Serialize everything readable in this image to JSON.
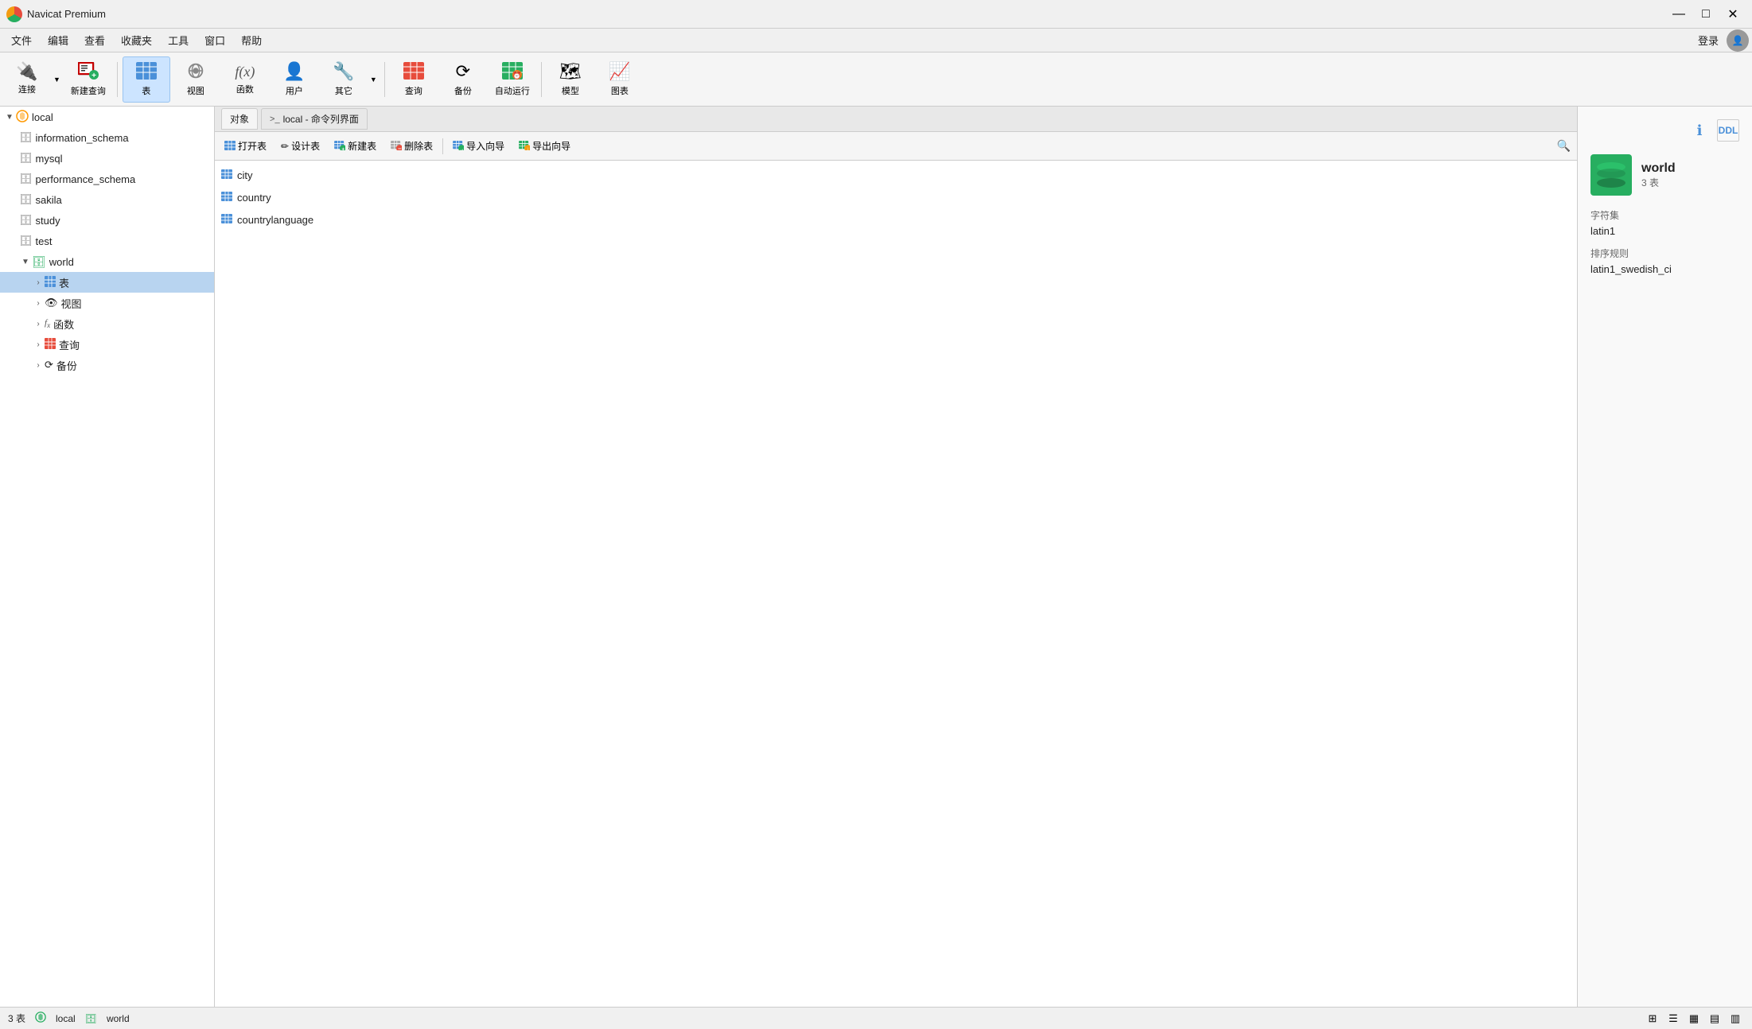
{
  "titleBar": {
    "title": "Navicat Premium",
    "minimizeLabel": "—",
    "maximizeLabel": "□",
    "closeLabel": "✕"
  },
  "menuBar": {
    "items": [
      "文件",
      "编辑",
      "查看",
      "收藏夹",
      "工具",
      "窗口",
      "帮助"
    ],
    "loginLabel": "登录"
  },
  "toolbar": {
    "buttons": [
      {
        "id": "connect",
        "label": "连接",
        "icon": "🔌",
        "hasArrow": true
      },
      {
        "id": "new-query",
        "label": "新建查询",
        "icon": "📋",
        "hasArrow": false
      },
      {
        "id": "table",
        "label": "表",
        "icon": "⊞",
        "hasArrow": false,
        "active": true
      },
      {
        "id": "view",
        "label": "视图",
        "icon": "👁",
        "hasArrow": false
      },
      {
        "id": "function",
        "label": "函数",
        "icon": "f(x)",
        "hasArrow": false
      },
      {
        "id": "user",
        "label": "用户",
        "icon": "👤",
        "hasArrow": false
      },
      {
        "id": "other",
        "label": "其它",
        "icon": "🔧",
        "hasArrow": true
      },
      {
        "id": "query",
        "label": "查询",
        "icon": "📊",
        "hasArrow": false
      },
      {
        "id": "backup",
        "label": "备份",
        "icon": "⟳",
        "hasArrow": false
      },
      {
        "id": "auto-run",
        "label": "自动运行",
        "icon": "⏰",
        "hasArrow": false
      },
      {
        "id": "model",
        "label": "模型",
        "icon": "🗺",
        "hasArrow": false
      },
      {
        "id": "chart",
        "label": "图表",
        "icon": "📈",
        "hasArrow": false
      }
    ]
  },
  "sidebar": {
    "items": [
      {
        "id": "local",
        "label": "local",
        "type": "connection",
        "level": 0,
        "expanded": true,
        "isConnection": true
      },
      {
        "id": "information_schema",
        "label": "information_schema",
        "type": "database",
        "level": 1
      },
      {
        "id": "mysql",
        "label": "mysql",
        "type": "database",
        "level": 1
      },
      {
        "id": "performance_schema",
        "label": "performance_schema",
        "type": "database",
        "level": 1
      },
      {
        "id": "sakila",
        "label": "sakila",
        "type": "database",
        "level": 1
      },
      {
        "id": "study",
        "label": "study",
        "type": "database",
        "level": 1
      },
      {
        "id": "test",
        "label": "test",
        "type": "database",
        "level": 1
      },
      {
        "id": "world",
        "label": "world",
        "type": "database",
        "level": 1,
        "expanded": true
      },
      {
        "id": "world-table",
        "label": "表",
        "type": "tables",
        "level": 2,
        "selected": true
      },
      {
        "id": "world-view",
        "label": "视图",
        "type": "views",
        "level": 2
      },
      {
        "id": "world-function",
        "label": "函数",
        "type": "functions",
        "level": 2
      },
      {
        "id": "world-query",
        "label": "查询",
        "type": "queries",
        "level": 2
      },
      {
        "id": "world-backup",
        "label": "备份",
        "type": "backups",
        "level": 2
      }
    ]
  },
  "tabBar": {
    "tabs": [
      {
        "label": "对象",
        "active": true
      },
      {
        "label": "local - 命令列界面",
        "active": false
      }
    ]
  },
  "actionBar": {
    "buttons": [
      {
        "id": "open-table",
        "label": "打开表",
        "icon": "⊞"
      },
      {
        "id": "design-table",
        "label": "设计表",
        "icon": "✏"
      },
      {
        "id": "new-table",
        "label": "新建表",
        "icon": "⊞"
      },
      {
        "id": "delete-table",
        "label": "删除表",
        "icon": "🗑"
      },
      {
        "id": "import-wizard",
        "label": "导入向导",
        "icon": "⊞"
      },
      {
        "id": "export-wizard",
        "label": "导出向导",
        "icon": "⊞"
      }
    ]
  },
  "tableList": {
    "tables": [
      {
        "name": "city"
      },
      {
        "name": "country"
      },
      {
        "name": "countrylanguage"
      }
    ]
  },
  "rightPanel": {
    "dbName": "world",
    "tableCount": "3 表",
    "charsetLabel": "字符集",
    "charsetValue": "latin1",
    "collationLabel": "排序规则",
    "collationValue": "latin1_swedish_ci"
  },
  "statusBar": {
    "tableCount": "3 表",
    "connectionName": "local",
    "dbName": "world"
  }
}
